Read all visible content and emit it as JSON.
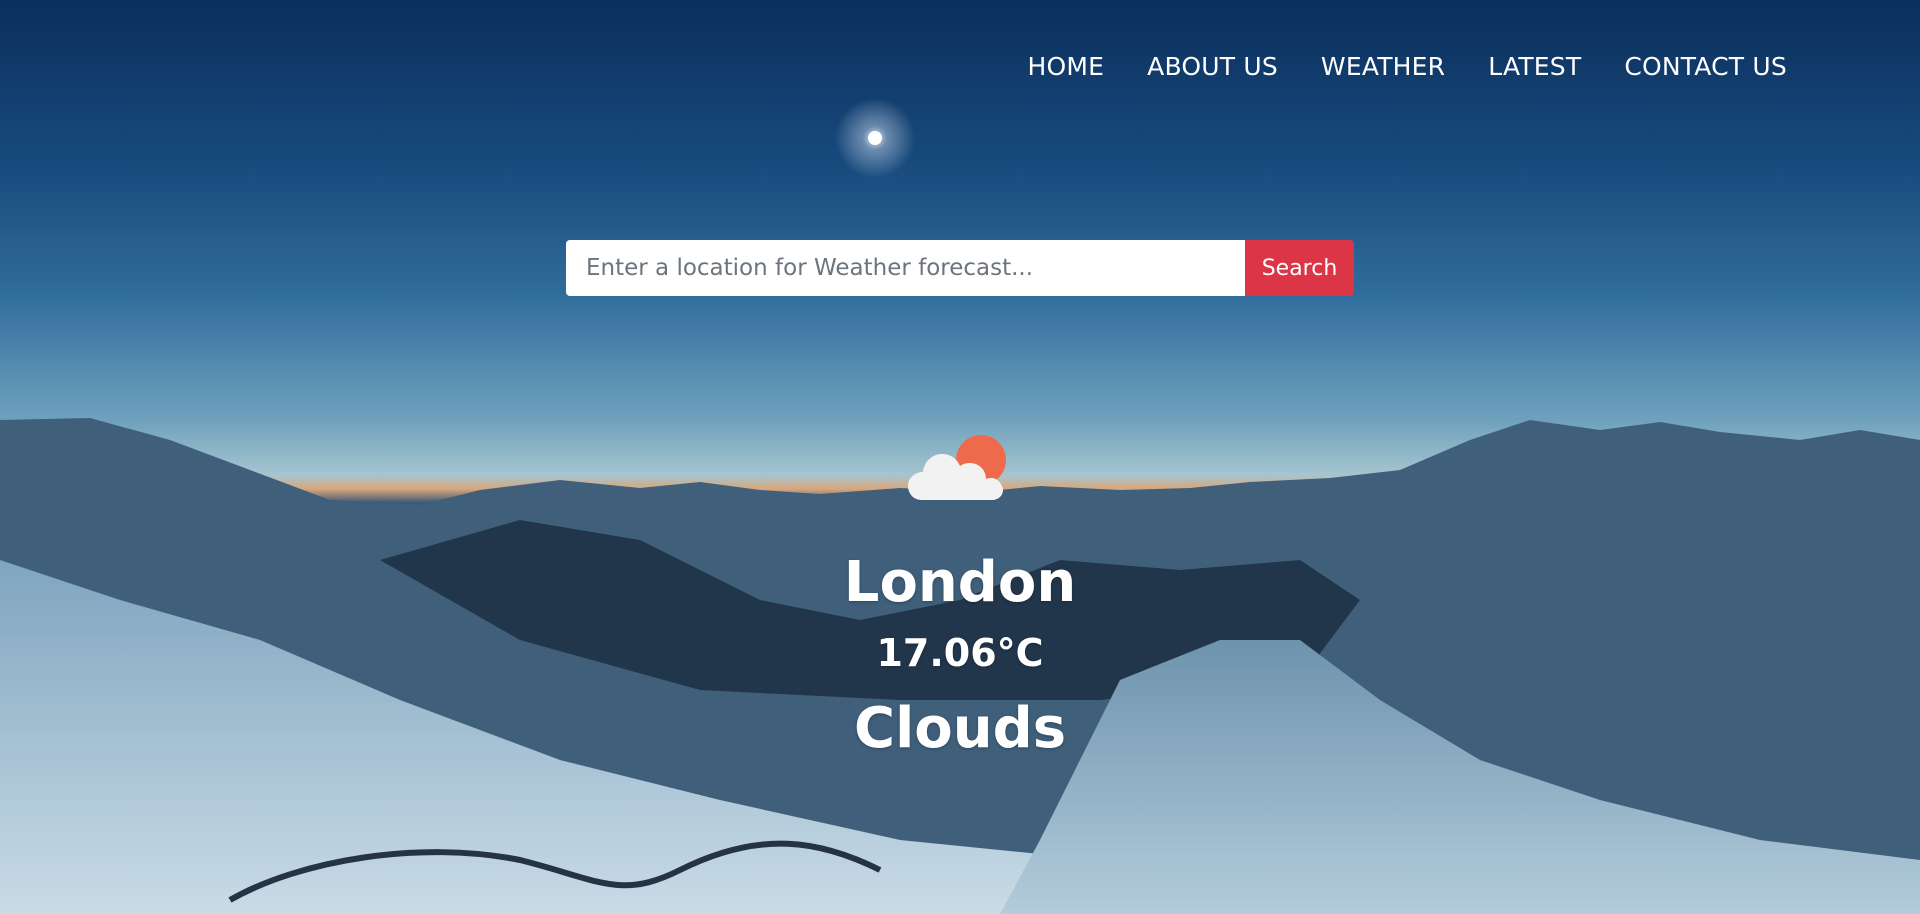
{
  "nav": {
    "items": [
      "HOME",
      "ABOUT US",
      "WEATHER",
      "LATEST",
      "CONTACT US"
    ]
  },
  "search": {
    "placeholder": "Enter a location for Weather forecast...",
    "button_label": "Search"
  },
  "weather": {
    "icon": "cloud-sun-icon",
    "city": "London",
    "temperature": "17.06°C",
    "condition": "Clouds"
  },
  "colors": {
    "search_button": "#dc3545",
    "sun": "#ef6a4c",
    "cloud": "#f2f2f2"
  }
}
